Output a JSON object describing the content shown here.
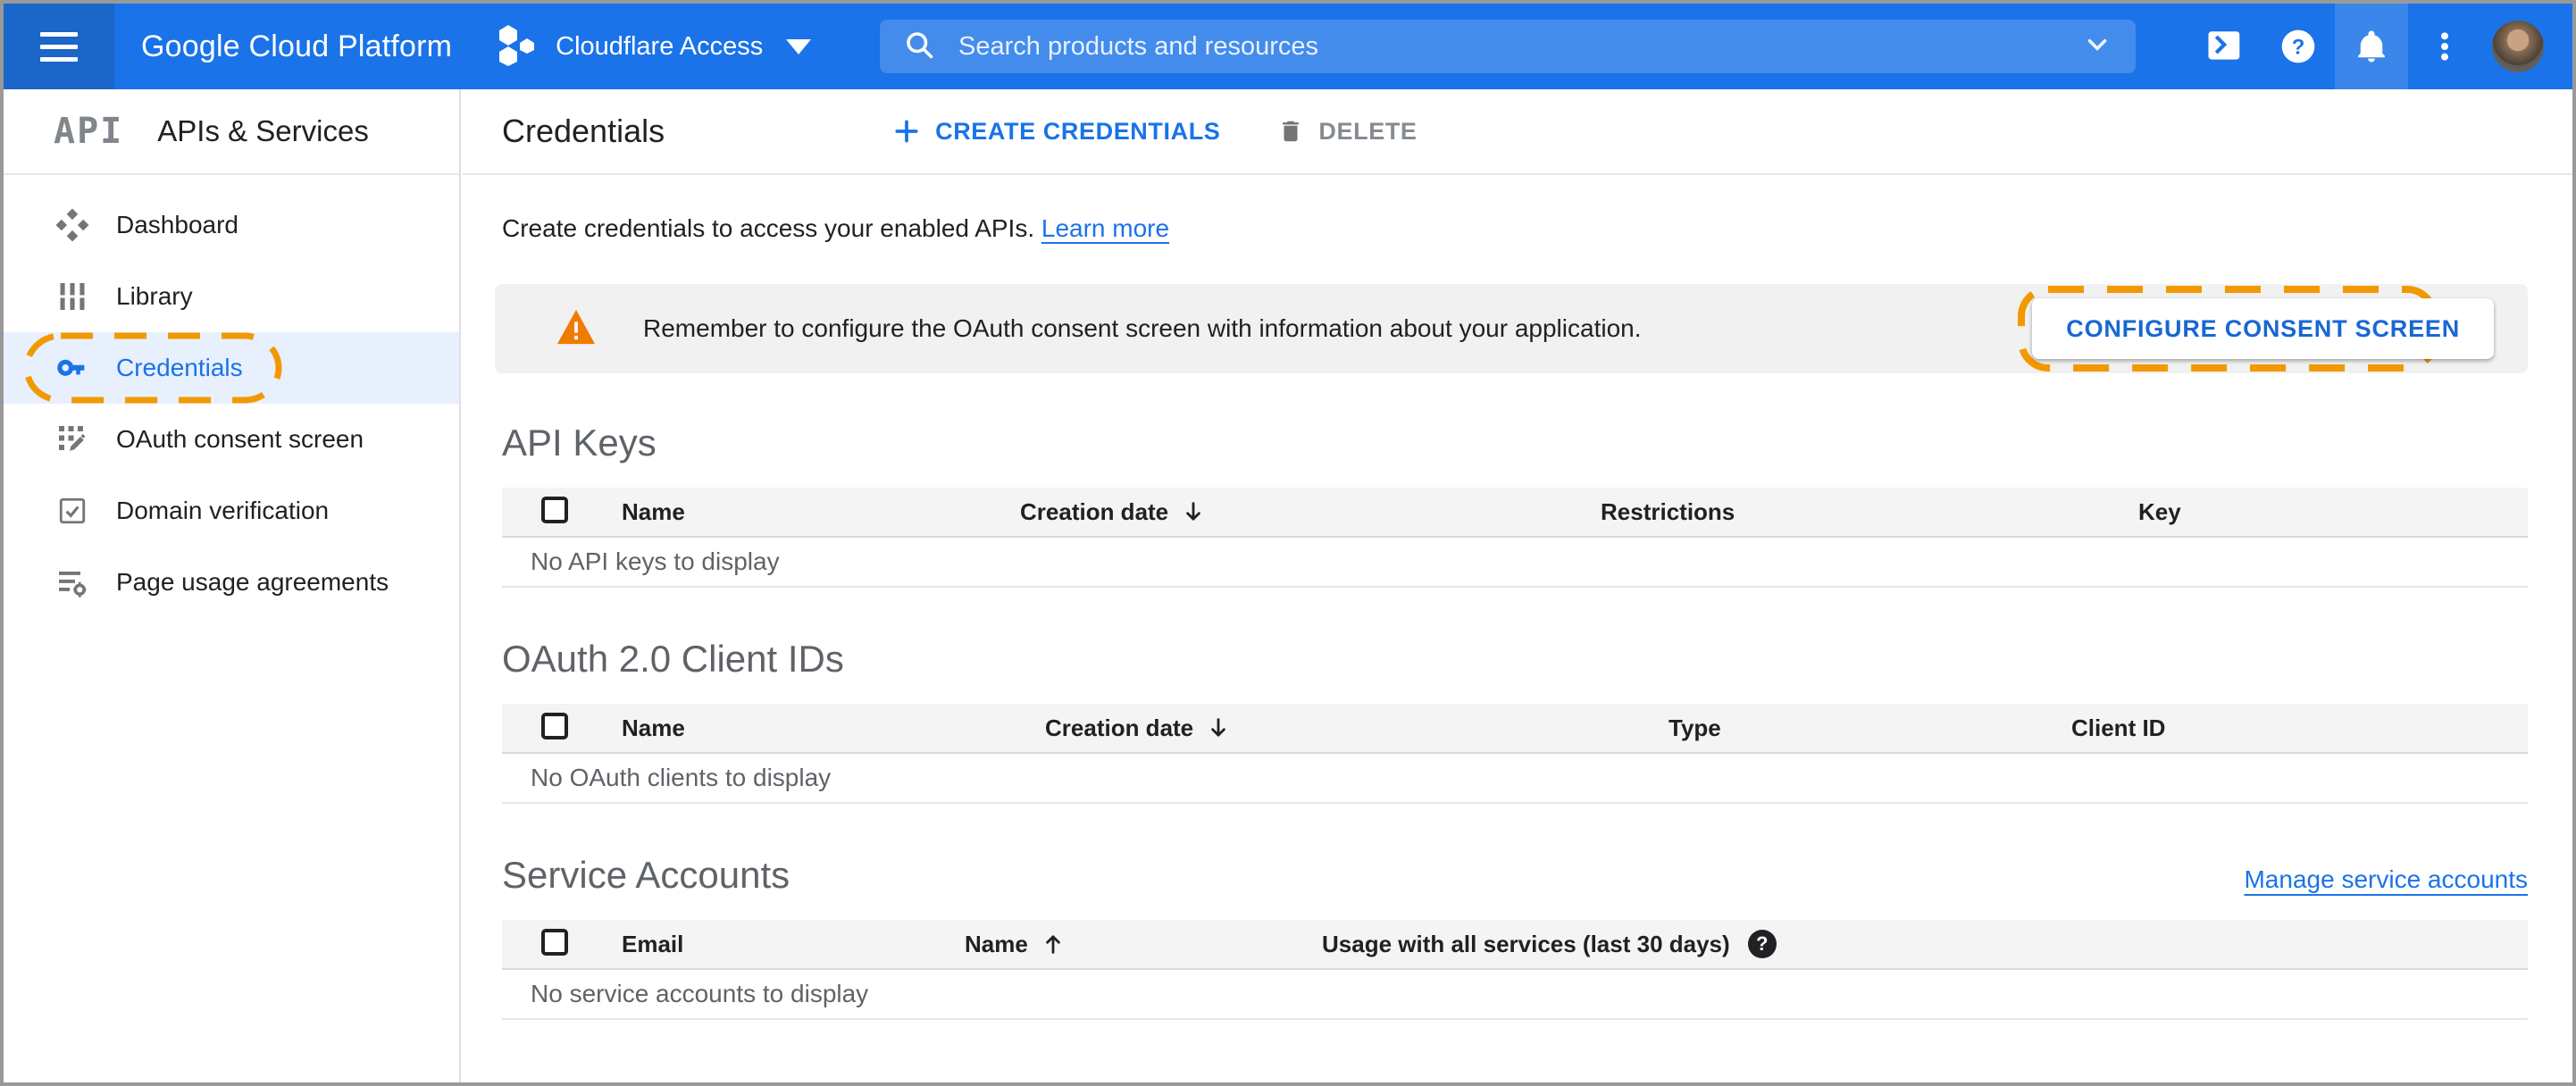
{
  "header": {
    "product_name": "Google Cloud Platform",
    "project_name": "Cloudflare Access",
    "search_placeholder": "Search products and resources"
  },
  "sidebar": {
    "logo_text": "API",
    "title": "APIs & Services",
    "items": [
      {
        "label": "Dashboard",
        "icon": "dashboard-icon",
        "active": false
      },
      {
        "label": "Library",
        "icon": "library-icon",
        "active": false
      },
      {
        "label": "Credentials",
        "icon": "key-icon",
        "active": true,
        "annotated": true
      },
      {
        "label": "OAuth consent screen",
        "icon": "consent-screen-icon",
        "active": false
      },
      {
        "label": "Domain verification",
        "icon": "domain-verification-icon",
        "active": false
      },
      {
        "label": "Page usage agreements",
        "icon": "page-agreements-icon",
        "active": false
      }
    ]
  },
  "toolbar": {
    "title": "Credentials",
    "create_button": "CREATE CREDENTIALS",
    "delete_button": "DELETE"
  },
  "intro": {
    "text": "Create credentials to access your enabled APIs. ",
    "link_label": "Learn more"
  },
  "banner": {
    "message": "Remember to configure the OAuth consent screen with information about your application.",
    "button_label": "CONFIGURE CONSENT SCREEN"
  },
  "sections": {
    "api_keys": {
      "title": "API Keys",
      "columns": [
        "Name",
        "Creation date",
        "Restrictions",
        "Key"
      ],
      "sort_column": "Creation date",
      "sort_direction": "desc",
      "empty_text": "No API keys to display"
    },
    "oauth_clients": {
      "title": "OAuth 2.0 Client IDs",
      "columns": [
        "Name",
        "Creation date",
        "Type",
        "Client ID"
      ],
      "sort_column": "Creation date",
      "sort_direction": "desc",
      "empty_text": "No OAuth clients to display"
    },
    "service_accounts": {
      "title": "Service Accounts",
      "link_label": "Manage service accounts",
      "columns": [
        "Email",
        "Name",
        "Usage with all services (last 30 days)"
      ],
      "sort_column": "Name",
      "sort_direction": "asc",
      "empty_text": "No service accounts to display"
    }
  },
  "icons": {
    "help_glyph": "?"
  },
  "colors": {
    "header_blue": "#1a73e8",
    "header_dark_blue": "#1b66c9",
    "accent_blue": "#1a73e8",
    "annotation_orange": "#f29900",
    "warning_orange": "#ef7c00",
    "banner_gray": "#f1f1f1",
    "selected_row_blue": "#e8f0fe"
  }
}
